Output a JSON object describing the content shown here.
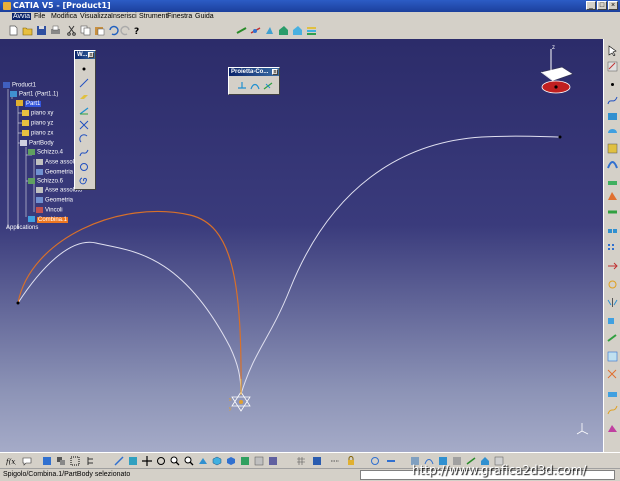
{
  "window": {
    "title": "CATIA V5 - [Product1]"
  },
  "menu": {
    "items": [
      "Avvia",
      "File",
      "Modifica",
      "Visualizza",
      "Inserisci",
      "Strumenti",
      "Finestra",
      "Guida"
    ]
  },
  "tree": {
    "nodes": [
      {
        "label": "Product1"
      },
      {
        "label": "Part1 (Part1.1)"
      },
      {
        "label": "Part1"
      },
      {
        "label": "piano xy"
      },
      {
        "label": "piano yz"
      },
      {
        "label": "piano zx"
      },
      {
        "label": "PartBody"
      },
      {
        "label": "Schizzo.4"
      },
      {
        "label": "Asse assoluto"
      },
      {
        "label": "Geometria"
      },
      {
        "label": "Schizzo.6"
      },
      {
        "label": "Asse assoluto"
      },
      {
        "label": "Geometria"
      },
      {
        "label": "Vincoli"
      },
      {
        "label": "Combina.1"
      },
      {
        "label": "Applications"
      }
    ]
  },
  "palettes": {
    "tools": {
      "title": "W..."
    },
    "project": {
      "title": "Proietta-Co..."
    }
  },
  "compass": {
    "axis_label": "z"
  },
  "axis_labels": {
    "x": "x",
    "y": "y"
  },
  "status": {
    "text": "Spigolo/Combina.1/PartBody selezionato"
  },
  "watermark": {
    "text": "http://www.grafica2d3d.com/"
  },
  "colors": {
    "titlebar": "#1c3f9c",
    "viewport_top": "#2c2c6a",
    "viewport_bottom": "#a5abc8",
    "curve": "#e0e0f0",
    "combined_curve": "#d8702a",
    "selection": "#3355dd",
    "selection_orange": "#ee7722"
  }
}
